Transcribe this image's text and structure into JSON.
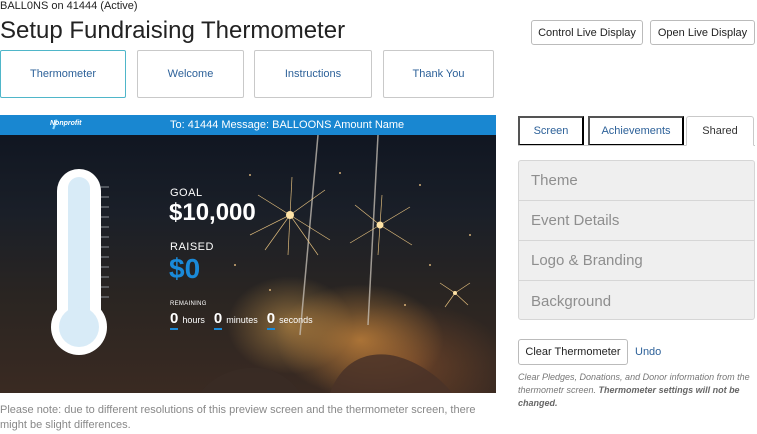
{
  "header": {
    "campaign_status": "BALL0NS on 41444 (Active)",
    "page_title": "Setup Fundraising Thermometer",
    "control_live_display": "Control Live Display",
    "open_live_display": "Open Live Display"
  },
  "main_tabs": [
    {
      "label": "Thermometer",
      "active": true
    },
    {
      "label": "Welcome",
      "active": false
    },
    {
      "label": "Instructions",
      "active": false
    },
    {
      "label": "Thank You",
      "active": false
    }
  ],
  "preview": {
    "brand": "Nonprofit",
    "text_instruction": "To: 41444 Message: BALLOONS Amount Name",
    "goal_label": "GOAL",
    "goal_amount": "$10,000",
    "raised_label": "RAISED",
    "raised_amount": "$0",
    "remaining_label": "REMAINING",
    "countdown": {
      "hours": "0",
      "hours_label": "hours",
      "minutes": "0",
      "minutes_label": "minutes",
      "seconds": "0",
      "seconds_label": "seconds"
    },
    "thermometer_fill_fraction": 0,
    "colors": {
      "bar": "#1987d1",
      "accent": "#1a8ad9"
    }
  },
  "preview_note": "Please note: due to different resolutions of this preview screen and the thermometer screen, there might be slight differences.",
  "side_tabs": [
    {
      "label": "Screen",
      "active": false
    },
    {
      "label": "Achievements",
      "active": false
    },
    {
      "label": "Shared",
      "active": true
    }
  ],
  "accordion": [
    {
      "label": "Theme"
    },
    {
      "label": "Event Details"
    },
    {
      "label": "Logo & Branding"
    },
    {
      "label": "Background"
    }
  ],
  "clear": {
    "button_label": "Clear Thermometer",
    "undo_label": "Undo",
    "note": "Clear Pledges, Donations, and Donor information from the thermometr screen.",
    "note_bold": "Thermometer settings will not be changed."
  }
}
